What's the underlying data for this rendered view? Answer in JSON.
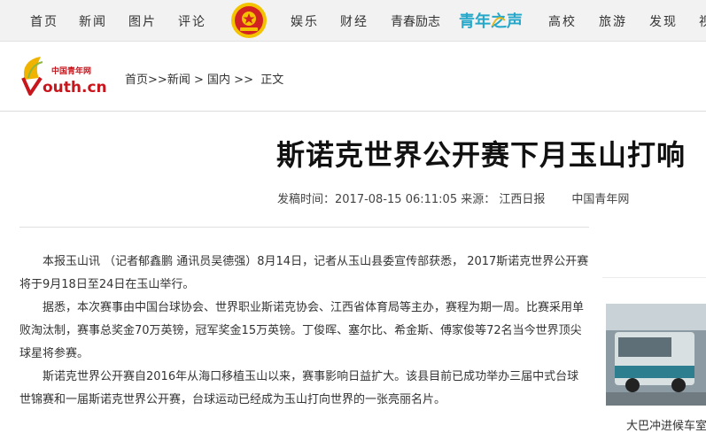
{
  "nav": {
    "items": [
      "首页",
      "新闻",
      "图片",
      "评论",
      "娱乐",
      "财经",
      "青春励志",
      "高校",
      "旅游",
      "发现",
      "视"
    ],
    "qnzs_logo_text": "青年之声",
    "emblem": "cyl-emblem-icon"
  },
  "logo": {
    "top_text": "中国青年网",
    "main_text": "outh.cn"
  },
  "breadcrumb": {
    "home": "首页",
    "sep1": ">>",
    "news": "新闻",
    "sep2": ">",
    "domestic": "国内",
    "sep3": ">>",
    "current": "正文"
  },
  "article": {
    "title": "斯诺克世界公开赛下月玉山打响",
    "meta_label": "发稿时间：",
    "publish_time": "2017-08-15 06:11:05",
    "source_label": "来源：",
    "source": "江西日报",
    "site": "中国青年网",
    "paragraphs": [
      "本报玉山讯 （记者郁鑫鹏 通讯员吴德强）8月14日，记者从玉山县委宣传部获悉， 2017斯诺克世界公开赛将于9月18日至24日在玉山举行。",
      "据悉，本次赛事由中国台球协会、世界职业斯诺克协会、江西省体育局等主办，赛程为期一周。比赛采用单败淘汰制，赛事总奖金70万英镑，冠军奖金15万英镑。丁俊晖、塞尔比、希金斯、傅家俊等72名当今世界顶尖球星将参赛。",
      "斯诺克世界公开赛自2016年从海口移植玉山以来，赛事影响日益扩大。该县目前已成功举办三届中式台球世锦赛和一届斯诺克世界公开赛，台球运动已经成为玉山打向世界的一张亮丽名片。"
    ]
  },
  "sidebar": {
    "thumb_caption": "大巴冲进候车室"
  }
}
